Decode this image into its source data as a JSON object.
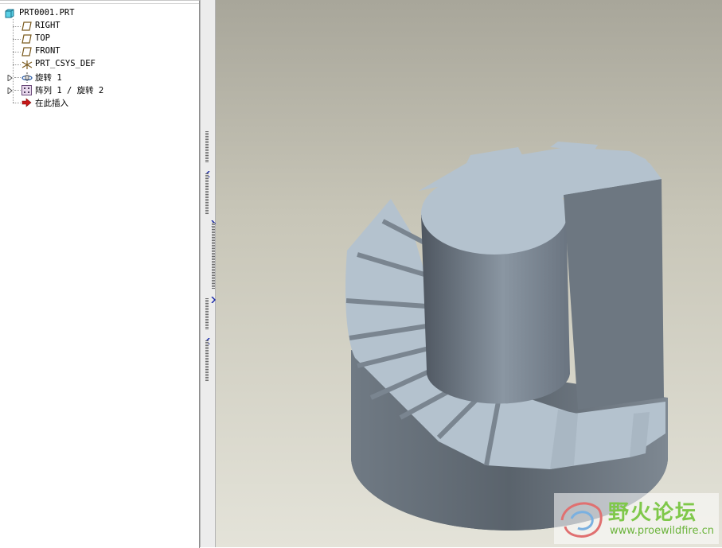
{
  "model_tree": {
    "root": "PRT0001.PRT",
    "items": [
      {
        "label": "RIGHT",
        "icon": "datum-plane-icon"
      },
      {
        "label": "TOP",
        "icon": "datum-plane-icon"
      },
      {
        "label": "FRONT",
        "icon": "datum-plane-icon"
      },
      {
        "label": "PRT_CSYS_DEF",
        "icon": "coordinate-system-icon"
      },
      {
        "label": "旋转 1",
        "icon": "revolve-feature-icon",
        "expandable": true
      },
      {
        "label": "阵列 1 / 旋转 2",
        "icon": "pattern-feature-icon",
        "expandable": true
      },
      {
        "label": "在此插入",
        "icon": "insert-here-arrow-icon"
      }
    ]
  },
  "viewport": {
    "background_top": "#a8a69a",
    "background_bottom": "#e4e3d9",
    "model_color": "#b4c2ce"
  },
  "watermark": {
    "title": "野火论坛",
    "url": "www.proewildfire.cn"
  }
}
